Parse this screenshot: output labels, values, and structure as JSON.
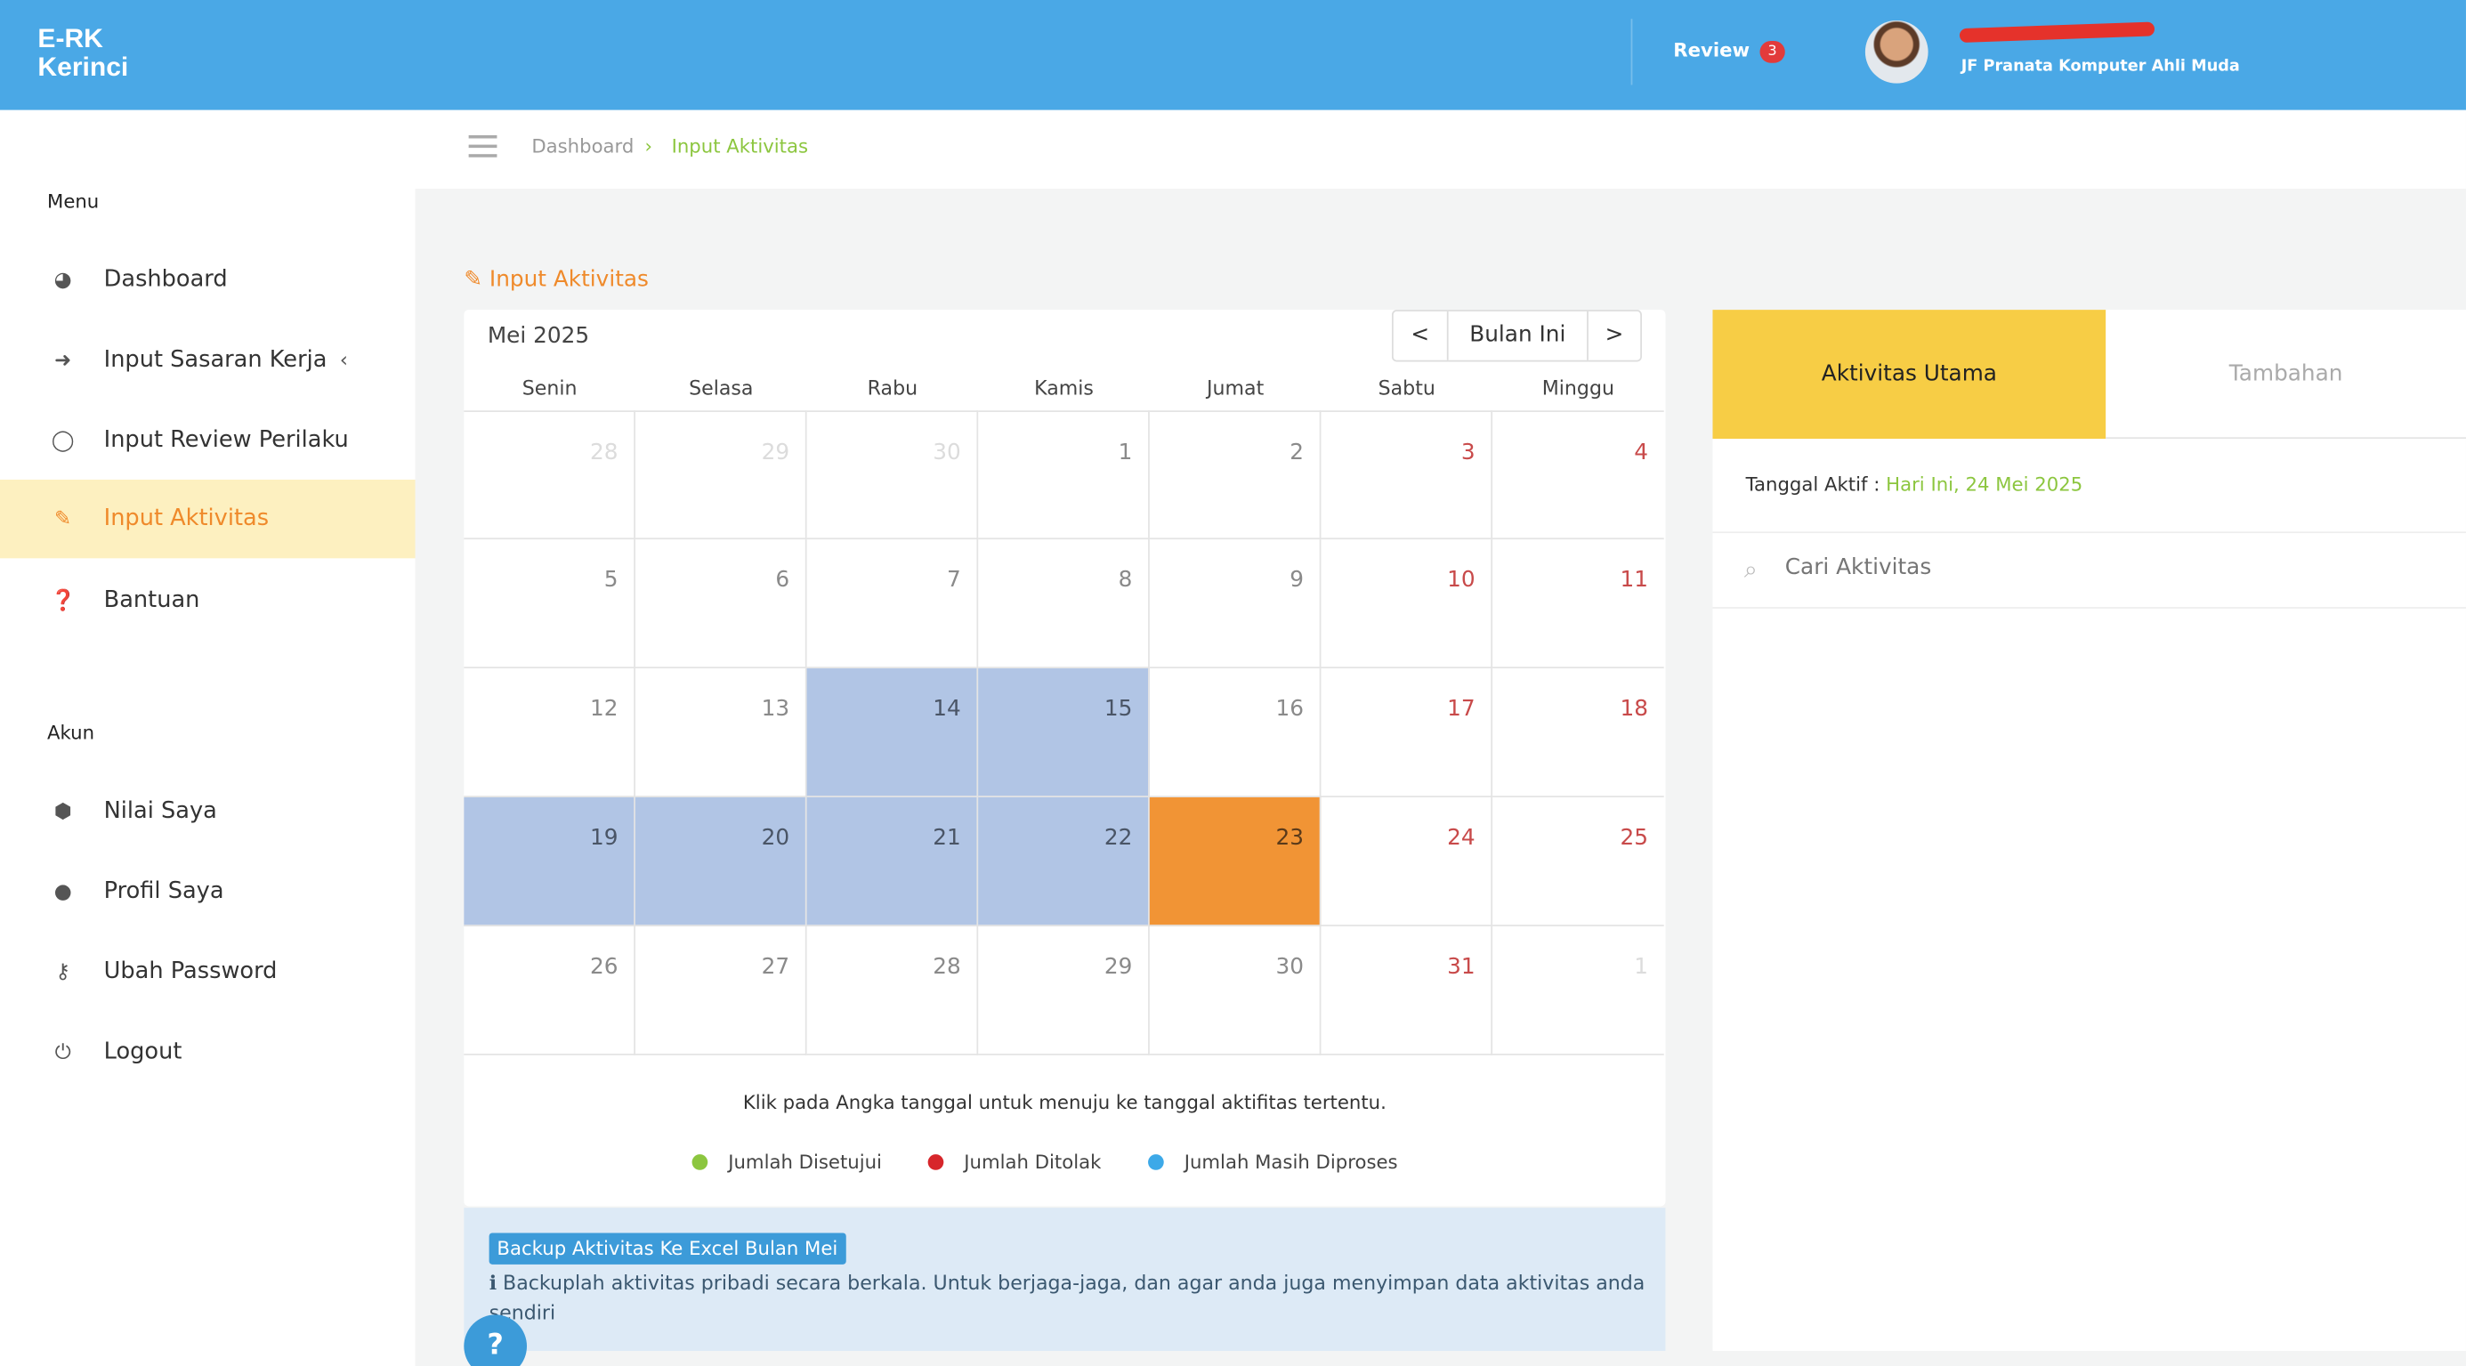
{
  "app": {
    "logo_line1": "E-RK",
    "logo_line2": "Kerinci"
  },
  "topbar": {
    "review_label": "Review",
    "review_count": "3",
    "job_title": "JF Pranata Komputer Ahli Muda"
  },
  "sidebar": {
    "menu_heading": "Menu",
    "menu_items": [
      {
        "label": "Dashboard",
        "icon": "dashboard-icon"
      },
      {
        "label": "Input Sasaran Kerja",
        "icon": "arrow-right-icon"
      },
      {
        "label": "Input Review Perilaku",
        "icon": "comment-icon"
      },
      {
        "label": "Input Aktivitas",
        "icon": "edit-icon"
      },
      {
        "label": "Bantuan",
        "icon": "question-circle-icon"
      }
    ],
    "account_heading": "Akun",
    "account_items": [
      {
        "label": "Nilai Saya",
        "icon": "cube-icon"
      },
      {
        "label": "Profil Saya",
        "icon": "user-icon"
      },
      {
        "label": "Ubah Password",
        "icon": "key-icon"
      },
      {
        "label": "Logout",
        "icon": "power-icon"
      }
    ]
  },
  "breadcrumb": {
    "home": "Dashboard",
    "current": "Input Aktivitas"
  },
  "page_title": "Input Aktivitas",
  "calendar": {
    "month_label": "Mei 2025",
    "prev": "<",
    "today_btn": "Bulan Ini",
    "next": ">",
    "weekdays": [
      "Senin",
      "Selasa",
      "Rabu",
      "Kamis",
      "Jumat",
      "Sabtu",
      "Minggu"
    ],
    "days": [
      "28",
      "29",
      "30",
      "1",
      "2",
      "3",
      "4",
      "5",
      "6",
      "7",
      "8",
      "9",
      "10",
      "11",
      "12",
      "13",
      "14",
      "15",
      "16",
      "17",
      "18",
      "19",
      "20",
      "21",
      "22",
      "23",
      "24",
      "25",
      "26",
      "27",
      "28",
      "29",
      "30",
      "31",
      "1"
    ],
    "note": "Klik pada Angka tanggal untuk menuju ke tanggal aktifitas tertentu.",
    "legend": [
      {
        "label": "Jumlah Disetujui",
        "color": "#8cc63f"
      },
      {
        "label": "Jumlah Ditolak",
        "color": "#d7262b"
      },
      {
        "label": "Jumlah Masih Diproses",
        "color": "#3da9e8"
      }
    ]
  },
  "backup": {
    "button": "Backup Aktivitas Ke Excel Bulan Mei",
    "text": "Backuplah aktivitas pribadi secara berkala. Untuk berjaga-jaga, dan agar anda juga menyimpan data aktivitas anda sendiri"
  },
  "help_label": "?",
  "right_panel": {
    "tab_main": "Aktivitas Utama",
    "tab_extra": "Tambahan",
    "active_date_label": "Tanggal Aktif :",
    "active_date_value": "Hari Ini, 24 Mei 2025",
    "search_placeholder": "Cari Aktivitas"
  },
  "colors": {
    "accent": "#ef8a2b",
    "topbar": "#4aa8e6",
    "highlight_week": "#b1c5e5",
    "today": "#f19435",
    "weekend_text": "#c84a4a"
  }
}
